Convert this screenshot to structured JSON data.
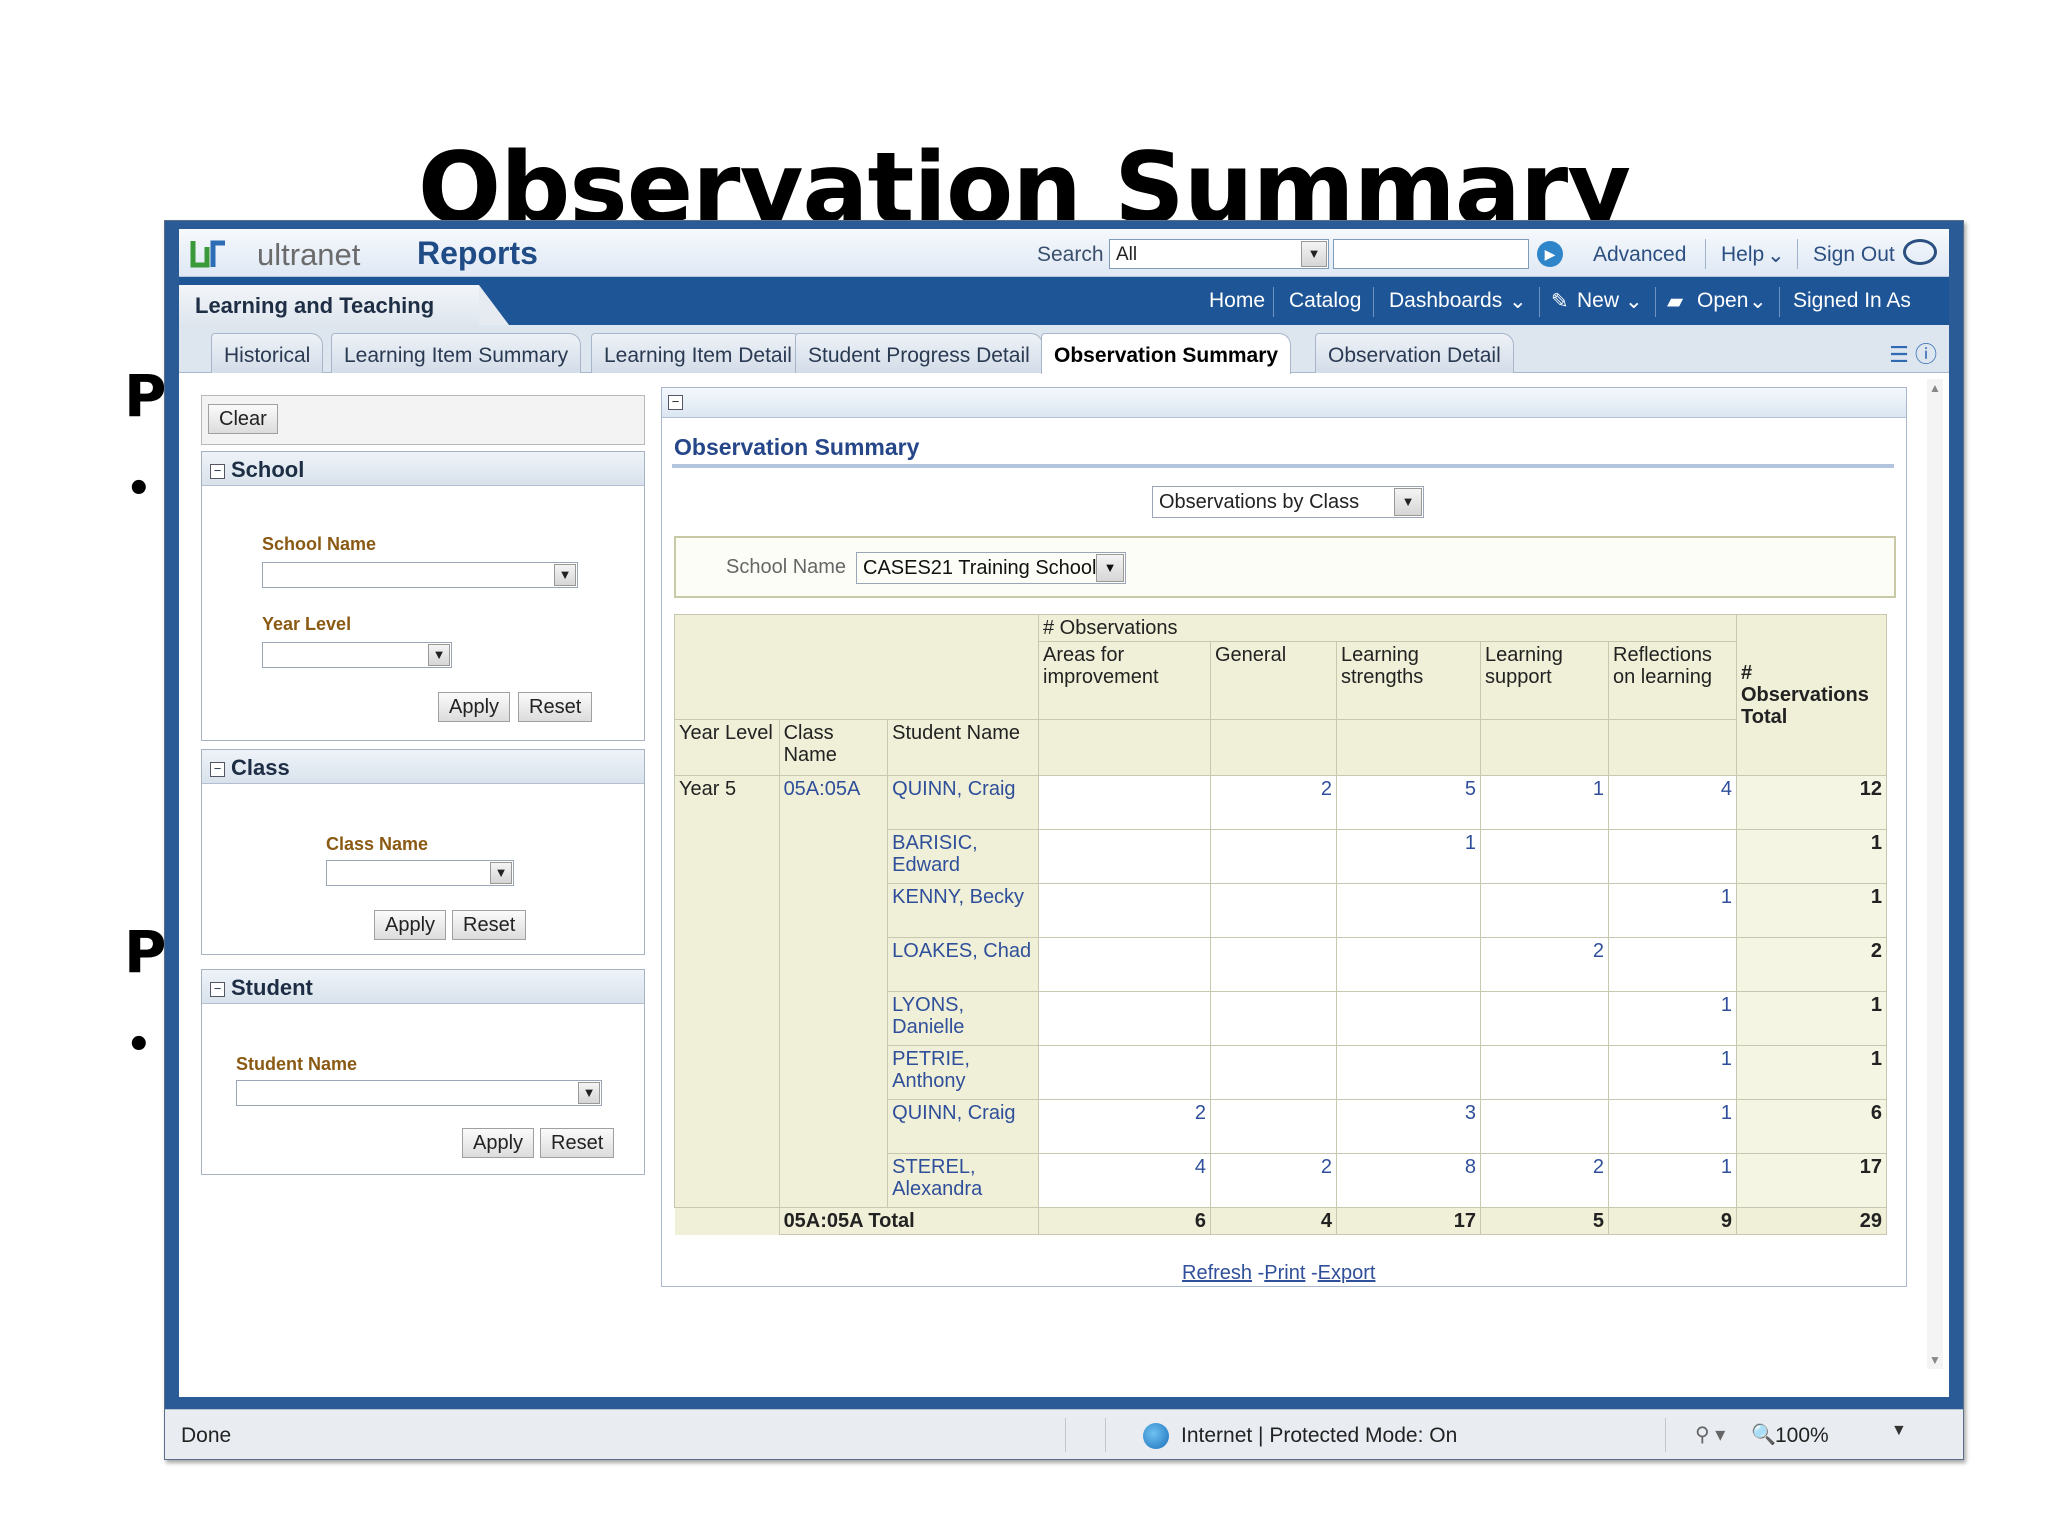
{
  "slide": {
    "title": "Observation Summary",
    "frag_p1": "P",
    "frag_bullet1": "•",
    "frag_p2": "P",
    "frag_bullet2": "•"
  },
  "topbar": {
    "brand_light": "ultranet",
    "brand_bold": "Reports",
    "search_label": "Search",
    "search_scope": "All",
    "links": [
      "Advanced",
      "Help",
      "Sign Out"
    ]
  },
  "navbar": {
    "section": "Learning and Teaching",
    "links": [
      "Home",
      "Catalog",
      "Dashboards",
      "New",
      "Open",
      "Signed In As"
    ]
  },
  "tabs": [
    "Historical",
    "Learning Item Summary",
    "Learning Item Detail",
    "Student Progress Detail",
    "Observation Summary",
    "Observation Detail"
  ],
  "filters": {
    "clear": "Clear",
    "school": {
      "title": "School",
      "school_name": "School Name",
      "year_level": "Year Level"
    },
    "class": {
      "title": "Class",
      "class_name": "Class Name"
    },
    "student": {
      "title": "Student",
      "student_name": "Student Name"
    },
    "apply": "Apply",
    "reset": "Reset"
  },
  "report": {
    "title": "Observation Summary",
    "view": "Observations by Class",
    "school_label": "School Name",
    "school_value": "CASES21 Training School",
    "group_header": "# Observations",
    "columns": [
      "Areas for improvement",
      "General",
      "Learning strengths",
      "Learning support",
      "Reflections on learning"
    ],
    "total_header": "# Observations Total",
    "row_headers": [
      "Year Level",
      "Class Name",
      "Student Name"
    ],
    "year_level": "Year 5",
    "class_name": "05A:05A",
    "rows": [
      {
        "student": "QUINN, Craig",
        "values": [
          "",
          "2",
          "5",
          "1",
          "4"
        ],
        "total": "12"
      },
      {
        "student": "BARISIC, Edward",
        "values": [
          "",
          "",
          "1",
          "",
          ""
        ],
        "total": "1"
      },
      {
        "student": "KENNY, Becky",
        "values": [
          "",
          "",
          "",
          "",
          "1"
        ],
        "total": "1"
      },
      {
        "student": "LOAKES, Chad",
        "values": [
          "",
          "",
          "",
          "2",
          ""
        ],
        "total": "2"
      },
      {
        "student": "LYONS, Danielle",
        "values": [
          "",
          "",
          "",
          "",
          "1"
        ],
        "total": "1"
      },
      {
        "student": "PETRIE, Anthony",
        "values": [
          "",
          "",
          "",
          "",
          "1"
        ],
        "total": "1"
      },
      {
        "student": "QUINN, Craig",
        "values": [
          "2",
          "",
          "3",
          "",
          "1"
        ],
        "total": "6"
      },
      {
        "student": "STEREL, Alexandra",
        "values": [
          "4",
          "2",
          "8",
          "2",
          "1"
        ],
        "total": "17"
      }
    ],
    "total_label": "05A:05A Total",
    "totals": [
      "6",
      "4",
      "17",
      "5",
      "9"
    ],
    "grand_total": "29",
    "links": {
      "refresh": "Refresh",
      "print": "Print",
      "export": "Export",
      "sep": "-"
    }
  },
  "status": {
    "done": "Done",
    "zone": "Internet | Protected Mode: On",
    "zoom": "100%"
  }
}
